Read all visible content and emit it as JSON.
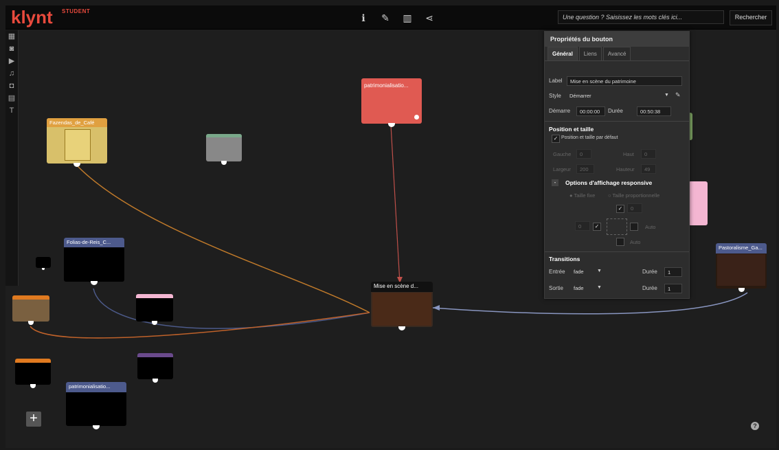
{
  "app": {
    "logo": "klynt",
    "logo_sup": "STUDENT"
  },
  "toolbar": {
    "icons": [
      "info-icon",
      "pencil-icon",
      "map-icon",
      "share-icon"
    ],
    "info_glyph": "ℹ",
    "pencil_glyph": "✎",
    "map_glyph": "▥",
    "share_glyph": "⋖"
  },
  "search": {
    "placeholder": "Une question ? Saisissez les mots clés ici...",
    "button": "Rechercher"
  },
  "leftbar": {
    "glyphs": [
      "▦",
      "◙",
      "▶",
      "♫",
      "◘",
      "▤",
      "T"
    ]
  },
  "nodes": {
    "patrimonialisation_top": "patrimonialisatio...",
    "fazendas": "Fazendas_de_Café",
    "folias": "Folias-de-Reis_C...",
    "mise_en_scene": "Mise en scène d...",
    "pastoralisme": "Pastoralisme_Ga...",
    "patrimonialisation_bottom": "patrimonialisatio..."
  },
  "panel": {
    "title": "Propriétés du bouton",
    "tabs": [
      "Général",
      "Liens",
      "Avancé"
    ],
    "label_lbl": "Label",
    "label_val": "Mise en scène du patrimoine",
    "style_lbl": "Style",
    "style_val": "Démarrer",
    "start_lbl": "Démarre",
    "start_val": "00:00:00",
    "dur_lbl": "Durée",
    "dur_val": "00:50:38",
    "pos_title": "Position et taille",
    "pos_default": "Position et taille par défaut",
    "gauche_lbl": "Gauche",
    "gauche_val": "0",
    "haut_lbl": "Haut",
    "haut_val": "0",
    "largeur_lbl": "Largeur",
    "largeur_val": "200",
    "hauteur_lbl": "Hauteur",
    "hauteur_val": "49",
    "resp_title": "Options d'affichage responsive",
    "taille_fixe": "Taille fixe",
    "taille_prop": "Taille proportionnelle",
    "val_0a": "0",
    "val_0b": "0",
    "auto1": "Auto",
    "auto2": "Auto",
    "trans_title": "Transitions",
    "entree_lbl": "Entrée",
    "entree_val": "fade",
    "entree_dur_lbl": "Durée",
    "entree_dur_val": "1",
    "sortie_lbl": "Sortie",
    "sortie_val": "fade",
    "sortie_dur_lbl": "Durée",
    "sortie_dur_val": "1"
  },
  "controls": {
    "add": "+",
    "help": "?"
  }
}
